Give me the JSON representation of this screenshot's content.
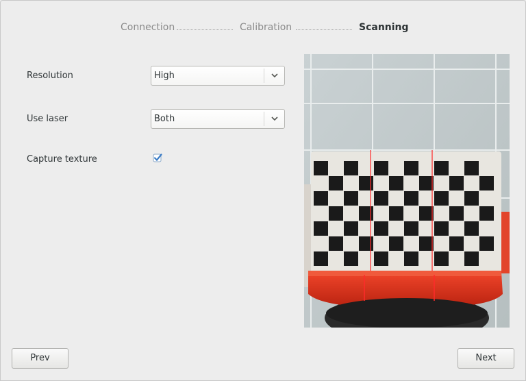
{
  "steps": [
    {
      "label": "Connection",
      "state": "done"
    },
    {
      "label": "Calibration",
      "state": "done"
    },
    {
      "label": "Scanning",
      "state": "active"
    }
  ],
  "form": {
    "resolution": {
      "label": "Resolution",
      "value": "High"
    },
    "use_laser": {
      "label": "Use laser",
      "value": "Both"
    },
    "capture_texture": {
      "label": "Capture texture",
      "checked": true
    }
  },
  "preview": {
    "description_icon": "camera-feed",
    "checker_color_dark": "#1a1a1a",
    "checker_color_light": "#e8e6e0",
    "turntable_color": "#e53a1e",
    "laser_color": "#ff2a2a"
  },
  "buttons": {
    "prev": "Prev",
    "next": "Next"
  },
  "colors": {
    "background": "#ededed",
    "active_step": "#2e3436",
    "inactive_step": "#8a8a8a",
    "checkbox_accent": "#4a90d9"
  }
}
